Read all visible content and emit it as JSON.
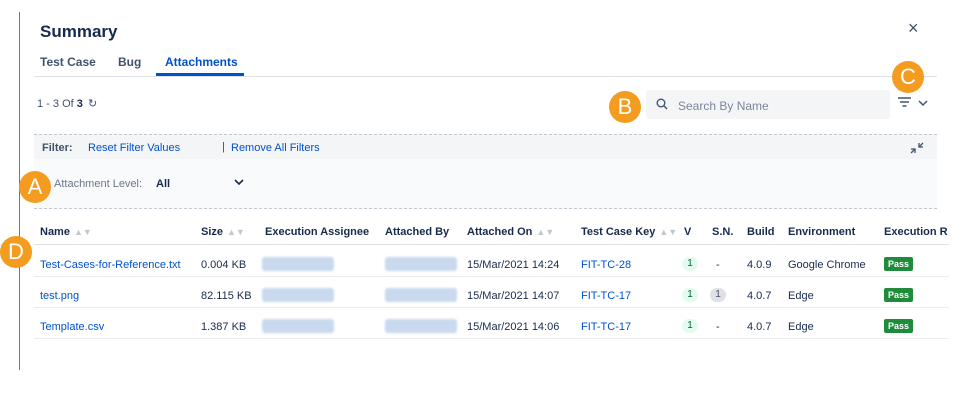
{
  "modal": {
    "title": "Summary",
    "close_icon": "×"
  },
  "tabs": [
    {
      "label": "Test Case",
      "active": false
    },
    {
      "label": "Bug",
      "active": false
    },
    {
      "label": "Attachments",
      "active": true
    }
  ],
  "pager": {
    "range": "1 - 3 Of",
    "total": "3",
    "refresh_icon": "↻"
  },
  "search": {
    "placeholder": "Search By Name",
    "value": ""
  },
  "filter": {
    "label": "Filter:",
    "reset_link": "Reset Filter Values",
    "separator": "|",
    "remove_link": "Remove All Filters"
  },
  "attachment_level": {
    "label": "Attachment Level:",
    "value": "All"
  },
  "badges": {
    "a": "A",
    "b": "B",
    "c": "C",
    "d": "D"
  },
  "colors": {
    "accent": "#0052cc",
    "badge": "#f39c20",
    "pass": "#1f8c3b"
  },
  "table": {
    "columns": [
      {
        "label": "Name",
        "sortable": true
      },
      {
        "label": "Size",
        "sortable": true
      },
      {
        "label": "Execution Assignee",
        "sortable": false
      },
      {
        "label": "Attached By",
        "sortable": false
      },
      {
        "label": "Attached On",
        "sortable": true
      },
      {
        "label": "Test Case Key",
        "sortable": true
      },
      {
        "label": "V",
        "sortable": false
      },
      {
        "label": "S.N.",
        "sortable": false
      },
      {
        "label": "Build",
        "sortable": false
      },
      {
        "label": "Environment",
        "sortable": false
      },
      {
        "label": "Execution R",
        "sortable": false
      }
    ],
    "rows": [
      {
        "name": "Test-Cases-for-Reference.txt",
        "size": "0.004 KB",
        "attached_on": "15/Mar/2021 14:24",
        "test_case_key": "FIT-TC-28",
        "v": "1",
        "sn": "-",
        "build": "4.0.9",
        "environment": "Google Chrome",
        "result": "Pass"
      },
      {
        "name": "test.png",
        "size": "82.115 KB",
        "attached_on": "15/Mar/2021 14:07",
        "test_case_key": "FIT-TC-17",
        "v": "1",
        "sn": "1",
        "build": "4.0.7",
        "environment": "Edge",
        "result": "Pass"
      },
      {
        "name": "Template.csv",
        "size": "1.387 KB",
        "attached_on": "15/Mar/2021 14:06",
        "test_case_key": "FIT-TC-17",
        "v": "1",
        "sn": "-",
        "build": "4.0.7",
        "environment": "Edge",
        "result": "Pass"
      }
    ]
  }
}
